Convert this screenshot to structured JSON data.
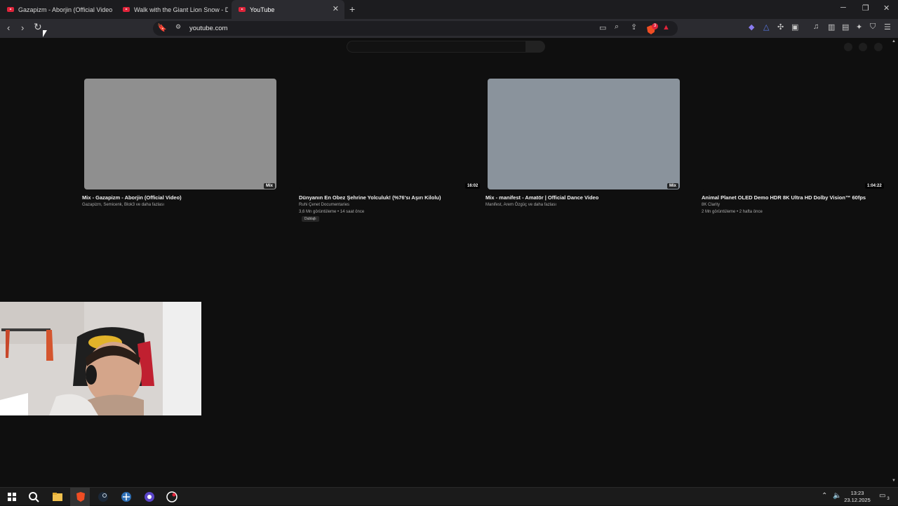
{
  "browser": {
    "tabs": [
      {
        "title": "Gazapizm - Aborjin (Official Video) -"
      },
      {
        "title": "Walk with the Giant Lion Snow - Dea"
      },
      {
        "title": "YouTube"
      }
    ],
    "new_tab": "+",
    "url": "youtube.com",
    "shields_badge": "3",
    "window_controls": {
      "minimize": "─",
      "restore": "❐",
      "close": "✕"
    }
  },
  "videos": [
    {
      "title": "Mix - Gazapizm - Aborjin (Official Video)",
      "meta1": "Gazapizm, Semicenk, Blok3 ve daha fazlası",
      "meta2": "",
      "badge": "Mix",
      "thumb_color": "#8f8f8f"
    },
    {
      "title": "Dünyanın En Obez Şehrine Yolculuk! (%76'sı Aşırı Kilolu)",
      "meta1": "Ruhi Çenet Documentaries",
      "meta2": "3,6 Mn görüntüleme • 14 saat önce",
      "chip": "Dublajlı",
      "badge": "16:02",
      "thumb_color": "#0f0f0f"
    },
    {
      "title": "Mix - manifest - Amatör | Official Dance Video",
      "meta1": "Manifest, Arem Özgüç ve daha fazlası",
      "meta2": "",
      "badge": "Mix",
      "thumb_color": "#8a939c"
    },
    {
      "title": "Animal Planet OLED Demo HDR 8K Ultra HD Dolby Vision™ 60fps",
      "meta1": "8K Clarity",
      "meta2": "2 Mn görüntüleme • 2 hafta önce",
      "badge": "1:04:22",
      "thumb_color": "#0f0f0f"
    }
  ],
  "taskbar": {
    "time": "13:23",
    "date": "23.12.2025",
    "notifications": "3"
  }
}
